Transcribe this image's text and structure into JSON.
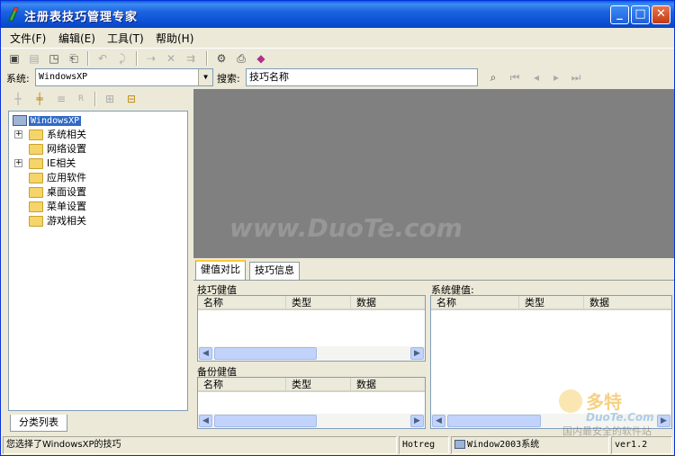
{
  "window": {
    "title": "注册表技巧管理专家"
  },
  "title_buttons": {
    "minimize": "_",
    "maximize": "□",
    "close": "✕"
  },
  "menu": [
    "文件(F)",
    "编辑(E)",
    "工具(T)",
    "帮助(H)"
  ],
  "toolbar_icons": [
    "open-icon",
    "save-icon",
    "add-icon",
    "edit-icon",
    "undo-icon",
    "redo-icon",
    "import-icon",
    "export-icon",
    "filter-icon",
    "options-icon",
    "run-icon",
    "help-book-icon"
  ],
  "sysrow": {
    "system_label": "系统:",
    "system_value": "WindowsXP",
    "search_label": "搜索:",
    "search_value": "技巧名称"
  },
  "tree": {
    "root": "WindowsXP",
    "items": [
      "系统相关",
      "网络设置",
      "IE相关",
      "应用软件",
      "桌面设置",
      "菜单设置",
      "游戏相关"
    ],
    "bottom_tab": "分类列表"
  },
  "preview": {
    "watermark": "www.DuoTe.com"
  },
  "tabs": [
    "健值对比",
    "技巧信息"
  ],
  "panels": {
    "tip_keys_label": "技巧健值",
    "backup_keys_label": "备份健值",
    "system_keys_label": "系统健值:",
    "col_name": "名称",
    "col_type": "类型",
    "col_data": "数据"
  },
  "status": {
    "message": "您选择了WindowsXP的技巧",
    "app": "Hotreg",
    "os": "Window2003系统",
    "version": "ver1.2"
  },
  "logo": {
    "big": "多特",
    "sub": "DuoTe.Com",
    "tag": "国内最安全的软件站"
  },
  "colors": {
    "titlebar": "#0A5FE6",
    "selection": "#316AC5",
    "preview_bg": "#808080",
    "face": "#ECE9D8"
  }
}
